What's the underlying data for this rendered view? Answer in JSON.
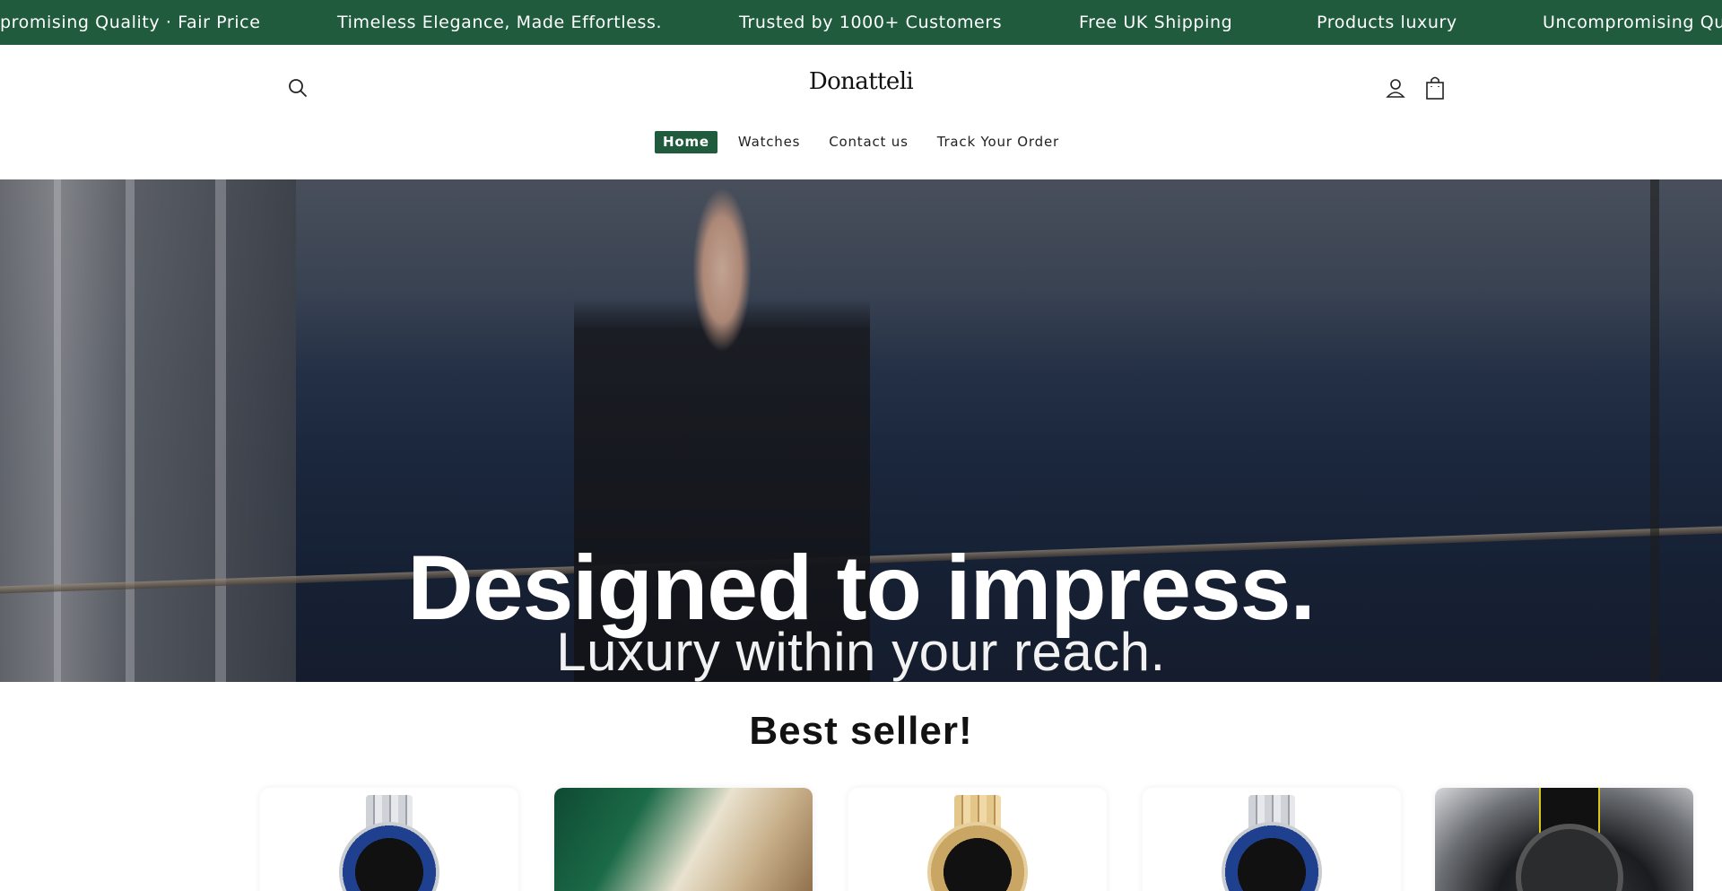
{
  "announcement_bar": {
    "items": [
      "promising Quality · Fair Price",
      "Timeless Elegance, Made Effortless.",
      "Trusted by 1000+ Customers",
      "Free UK Shipping",
      "Products luxury",
      "Uncompromising Qu"
    ]
  },
  "header": {
    "logo": "Donatteli",
    "nav": [
      {
        "label": "Home",
        "active": true
      },
      {
        "label": "Watches",
        "active": false
      },
      {
        "label": "Contact us",
        "active": false
      },
      {
        "label": "Track Your Order",
        "active": false
      }
    ],
    "icons": [
      "search-icon",
      "account-icon",
      "cart-icon"
    ]
  },
  "hero": {
    "title": "Designed to impress.",
    "subtitle": "Luxury within your reach."
  },
  "best_seller": {
    "title": "Best seller!",
    "products": [
      {
        "type": "watch",
        "bezel_color": "#1f3f8f"
      },
      {
        "type": "box"
      },
      {
        "type": "watch",
        "bezel_color": "#caa664"
      },
      {
        "type": "watch",
        "bezel_color": "#1f3f8f"
      },
      {
        "type": "omega"
      }
    ]
  },
  "colors": {
    "brand_green": "#1f5b3c",
    "text": "#121212"
  }
}
